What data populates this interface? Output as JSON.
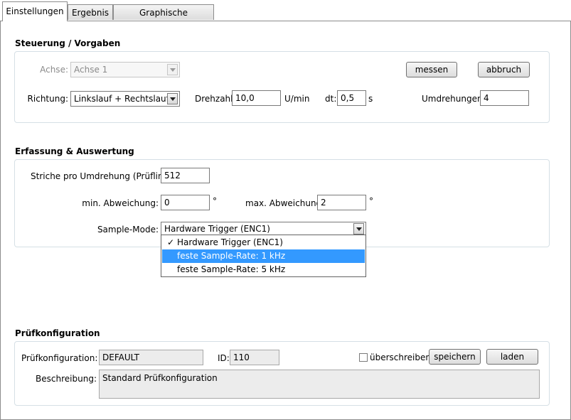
{
  "tabs": [
    {
      "label": "Einstellungen",
      "active": true
    },
    {
      "label": "Ergebnis",
      "active": false
    },
    {
      "label": "Graphische Darstellung",
      "active": false
    }
  ],
  "steuerung": {
    "title": "Steuerung / Vorgaben",
    "achse_label": "Achse:",
    "achse_value": "Achse 1",
    "richtung_label": "Richtung:",
    "richtung_value": "Linkslauf + Rechtslauf",
    "drehzahl_label": "Drehzahl:",
    "drehzahl_value": "10,0",
    "drehzahl_unit": "U/min",
    "dt_label": "dt:",
    "dt_value": "0,5",
    "dt_unit": "s",
    "umdrehungen_label": "Umdrehungen:",
    "umdrehungen_value": "4",
    "messen_label": "messen",
    "abbruch_label": "abbruch"
  },
  "erfassung": {
    "title": "Erfassung & Auswertung",
    "striche_label": "Striche pro Umdrehung (Prüfling):",
    "striche_value": "512",
    "min_label": "min. Abweichung:",
    "min_value": "0",
    "min_unit": "°",
    "max_label": "max. Abweichung:",
    "max_value": "2",
    "max_unit": "°",
    "sample_label": "Sample-Mode:",
    "sample_value": "Hardware Trigger (ENC1)",
    "sample_options": [
      {
        "label": "Hardware Trigger (ENC1)",
        "checked": true,
        "highlighted": false
      },
      {
        "label": "feste Sample-Rate: 1 kHz",
        "checked": false,
        "highlighted": true
      },
      {
        "label": "feste Sample-Rate: 5 kHz",
        "checked": false,
        "highlighted": false
      }
    ],
    "check_glyph": "✓"
  },
  "pruef": {
    "title": "Prüfkonfiguration",
    "config_label": "Prüfkonfiguration:",
    "config_value": "DEFAULT",
    "id_label": "ID:",
    "id_value": "110",
    "ueberschreiben_label": "überschreiben",
    "ueberschreiben_checked": false,
    "speichern_label": "speichern",
    "laden_label": "laden",
    "beschreibung_label": "Beschreibung:",
    "beschreibung_value": "Standard Prüfkonfiguration"
  },
  "colors": {
    "highlight": "#3399ff",
    "group_border": "#d5dfe5"
  }
}
